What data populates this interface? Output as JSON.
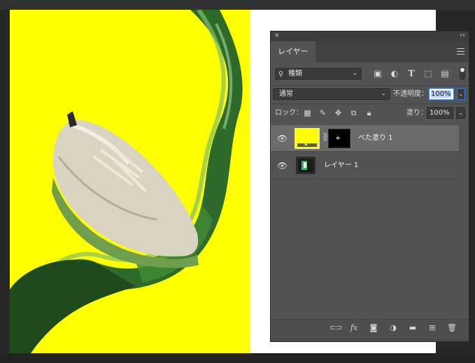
{
  "panel": {
    "tab_label": "レイヤー",
    "collapse_icon": "×",
    "expand_icon": "‹‹",
    "menu_icon": "hamburger-menu-icon",
    "filter": {
      "kind_label": "種類",
      "icons": [
        "image-filter-icon",
        "adjustment-filter-icon",
        "type-filter-icon",
        "shape-filter-icon",
        "smart-object-filter-icon"
      ]
    },
    "blend_mode": "通常",
    "opacity_label": "不透明度：",
    "opacity_value": "100%",
    "lock_label": "ロック：",
    "lock_icons": [
      "lock-transparent-icon",
      "lock-paint-icon",
      "lock-move-icon",
      "lock-artboard-icon",
      "lock-all-icon"
    ],
    "fill_label": "塗り：",
    "fill_value": "100%",
    "layers": [
      {
        "name": "べた塗り 1",
        "visible": true,
        "selected": true,
        "fill_color": "#ffff00"
      },
      {
        "name": "レイヤー 1",
        "visible": true,
        "selected": false
      }
    ],
    "footer_icons": [
      "link-layers-icon",
      "fx-icon",
      "add-mask-icon",
      "adjustment-layer-icon",
      "group-folder-icon",
      "new-layer-icon",
      "delete-icon"
    ]
  },
  "canvas": {
    "background_color": "#ffff00",
    "document_color": "#ffffff"
  }
}
